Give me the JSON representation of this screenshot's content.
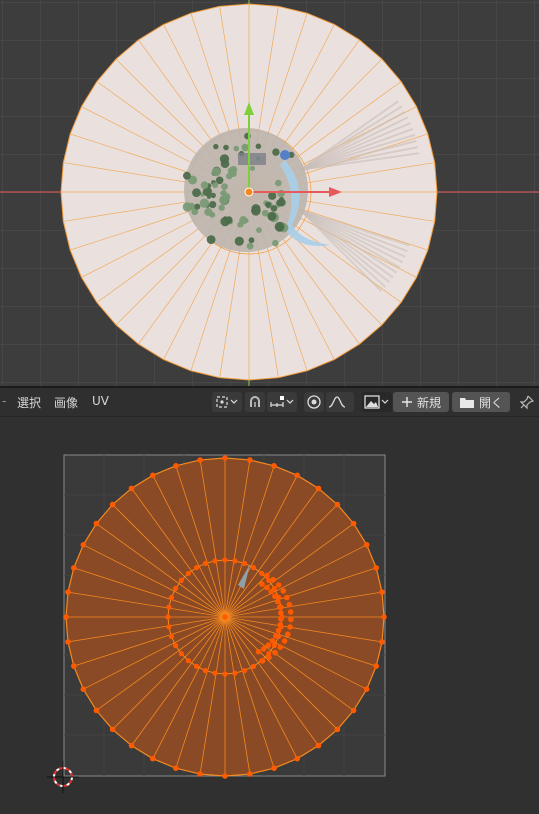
{
  "header": {
    "menu": [
      {
        "label": "選択"
      },
      {
        "label": "画像"
      },
      {
        "label": "UV"
      }
    ],
    "new_button": {
      "label": "新規",
      "icon": "plus-icon"
    },
    "open_button": {
      "label": "開く",
      "icon": "folder-icon"
    },
    "icons": [
      "pivot-icon",
      "snap-icon",
      "snap-mode-icon",
      "proportional-edit-icon",
      "falloff-icon",
      "image-browse-icon",
      "pin-icon"
    ]
  },
  "viewport": {
    "axis_colors": {
      "x": "#e85a5a",
      "y": "#7ecf3a"
    },
    "mesh_edge_color": "#f29b3a",
    "disc_fill": "#eae1de"
  },
  "uv_editor": {
    "face_fill": "#8a4a25",
    "edge_color": "#f5891e",
    "vertex_color": "#ff5a00",
    "bounds_color": "#8a8a8a",
    "cursor_icon": "2d-cursor-icon"
  }
}
